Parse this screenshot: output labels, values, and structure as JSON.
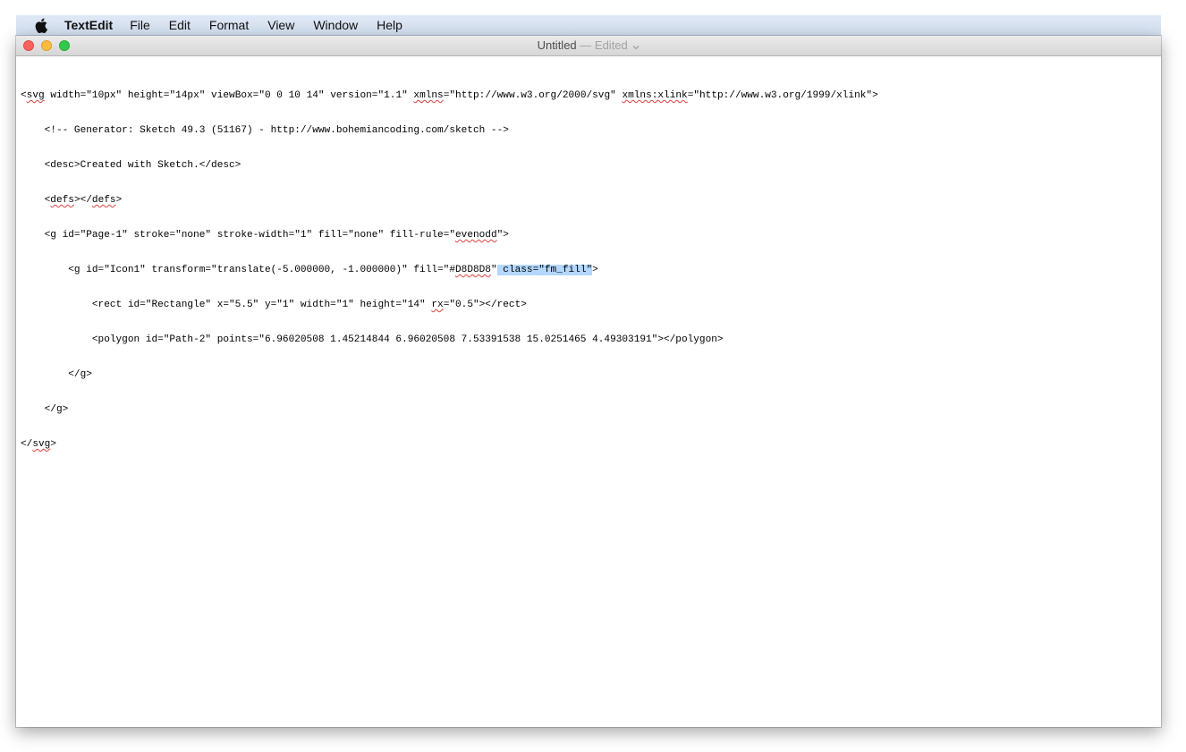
{
  "menubar": {
    "app_name": "TextEdit",
    "items": [
      "File",
      "Edit",
      "Format",
      "View",
      "Window",
      "Help"
    ]
  },
  "window": {
    "title": "Untitled",
    "title_separator": "—",
    "edited_label": "Edited"
  },
  "document": {
    "lines": [
      [
        "<",
        "svg",
        " width=\"10px\" height=\"14px\" viewBox=\"0 0 10 14\" version=\"1.1\" ",
        "xmlns",
        "=\"http://www.w3.org/2000/svg\" ",
        "xmlns:xlink",
        "=\"http://www.w3.org/1999/xlink\">"
      ],
      [
        "    <!-- Generator: Sketch 49.3 (51167) - http://www.bohemiancoding.com/sketch -->"
      ],
      [
        "    <desc>Created with Sketch.</desc>"
      ],
      [
        "    <",
        "defs",
        "></",
        "defs",
        ">"
      ],
      [
        "    <g id=\"Page-1\" stroke=\"none\" stroke-width=\"1\" fill=\"none\" fill-rule=\"",
        "evenodd",
        "\">"
      ],
      [
        "        <g id=\"Icon1\" transform=\"translate(-5.000000, -1.000000)\" fill=\"#",
        "D8D8D8",
        "\"",
        " class=\"fm_fill\"",
        ">"
      ],
      [
        "            <rect id=\"Rectangle\" x=\"5.5\" y=\"1\" width=\"1\" height=\"14\" ",
        "rx",
        "=\"0.5\"></rect>"
      ],
      [
        "            <polygon id=\"Path-2\" points=\"6.96020508 1.45214844 6.96020508 7.53391538 15.0251465 4.49303191\"></polygon>"
      ],
      [
        "        </g>"
      ],
      [
        "    </g>"
      ],
      [
        "</",
        "svg",
        ">"
      ]
    ]
  },
  "colors": {
    "menubar_bg": "#d6e1f1",
    "selection": "#b3d7ff",
    "spellcheck_underline": "#e0403f",
    "close": "#fc605c",
    "minimize": "#fdbc40",
    "zoom": "#34c84a"
  },
  "icons": {
    "apple": "apple-logo-icon",
    "title_chevron": "chevron-down-icon"
  }
}
